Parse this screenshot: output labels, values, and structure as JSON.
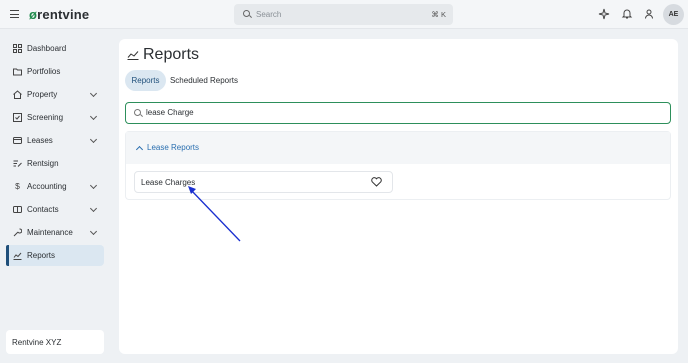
{
  "topbar": {
    "logo_text": "rentvine",
    "logo_mark": "ø",
    "search_placeholder": "Search",
    "search_shortcut": "⌘ K",
    "user_initials": "AE"
  },
  "sidebar": {
    "items": [
      {
        "label": "Dashboard",
        "icon": "dashboard-icon"
      },
      {
        "label": "Portfolios",
        "icon": "folder-icon"
      },
      {
        "label": "Property",
        "icon": "house-icon"
      },
      {
        "label": "Screening",
        "icon": "screening-icon"
      },
      {
        "label": "Leases",
        "icon": "lease-icon"
      },
      {
        "label": "Rentsign",
        "icon": "signature-icon"
      },
      {
        "label": "Accounting",
        "icon": "dollar-icon"
      },
      {
        "label": "Contacts",
        "icon": "contacts-icon"
      },
      {
        "label": "Maintenance",
        "icon": "wrench-icon"
      },
      {
        "label": "Reports",
        "icon": "reports-icon"
      }
    ],
    "org_name": "Rentvine XYZ"
  },
  "main": {
    "title": "Reports",
    "tabs": [
      {
        "label": "Reports"
      },
      {
        "label": "Scheduled Reports"
      }
    ],
    "filter_value": "lease Charge",
    "section_label": "Lease Reports",
    "report_item": "Lease Charges"
  },
  "colors": {
    "accent_blue": "#2a6fb0",
    "active_bg": "#dbe7f1",
    "filter_border": "#2d8f5b",
    "arrow": "#1a2fd0"
  }
}
